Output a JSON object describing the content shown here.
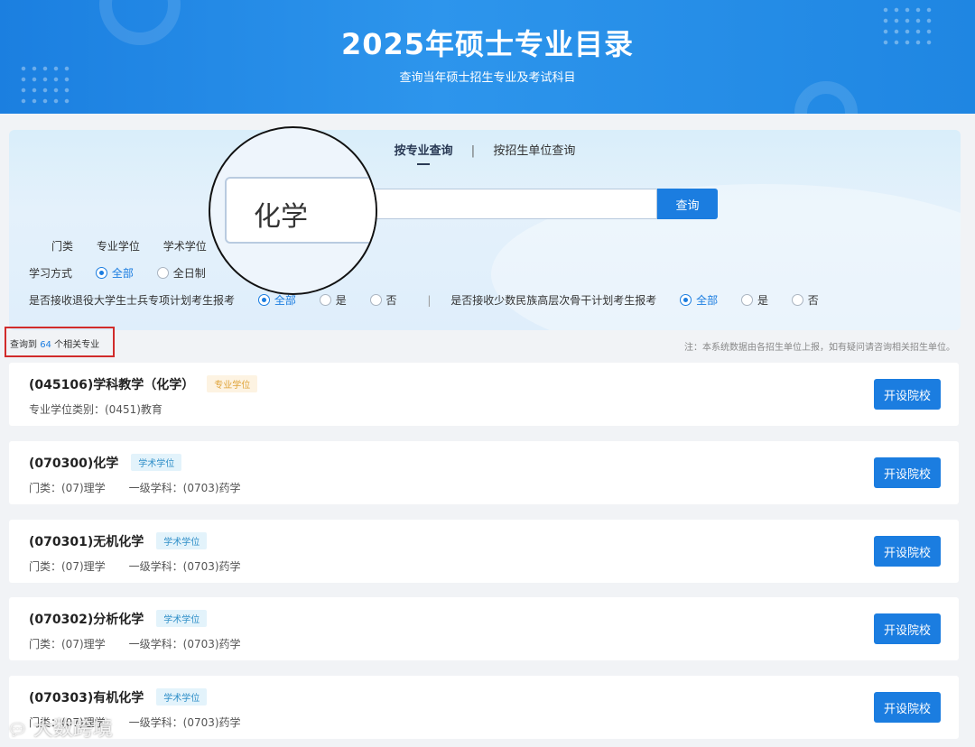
{
  "banner": {
    "title": "2025年硕士专业目录",
    "subtitle": "查询当年硕士招生专业及考试科目"
  },
  "tabs": [
    {
      "label": "按专业查询",
      "active": true
    },
    {
      "label": "按招生单位查询",
      "active": false
    }
  ],
  "tab_separator": "|",
  "search": {
    "value": "化学",
    "placeholder": "",
    "button_label": "查询"
  },
  "filters": {
    "category": {
      "label": "门类",
      "options": [
        "专业学位",
        "学术学位"
      ]
    },
    "study_mode": {
      "label": "学习方式",
      "options": [
        {
          "label": "全部",
          "selected": true
        },
        {
          "label": "全日制",
          "selected": false
        }
      ]
    },
    "veteran_plan": {
      "label": "是否接收退役大学生士兵专项计划考生报考",
      "options": [
        {
          "label": "全部",
          "selected": true
        },
        {
          "label": "是",
          "selected": false
        },
        {
          "label": "否",
          "selected": false
        }
      ]
    },
    "minority_plan": {
      "label": "是否接收少数民族高层次骨干计划考生报考",
      "options": [
        {
          "label": "全部",
          "selected": true
        },
        {
          "label": "是",
          "selected": false
        },
        {
          "label": "否",
          "selected": false
        }
      ]
    },
    "separator": "|"
  },
  "results": {
    "prefix": "查询到",
    "count": "64",
    "suffix": "个相关专业",
    "note": "注：本系统数据由各招生单位上报，如有疑问请咨询相关招生单位。"
  },
  "majors": [
    {
      "title": "(045106)学科教学（化学）",
      "tag": "专业学位",
      "tag_type": "pro",
      "meta": [
        "专业学位类别：(0451)教育"
      ],
      "button": "开设院校"
    },
    {
      "title": "(070300)化学",
      "tag": "学术学位",
      "tag_type": "aca",
      "meta": [
        "门类：(07)理学",
        "一级学科：(0703)药学"
      ],
      "button": "开设院校"
    },
    {
      "title": "(070301)无机化学",
      "tag": "学术学位",
      "tag_type": "aca",
      "meta": [
        "门类：(07)理学",
        "一级学科：(0703)药学"
      ],
      "button": "开设院校"
    },
    {
      "title": "(070302)分析化学",
      "tag": "学术学位",
      "tag_type": "aca",
      "meta": [
        "门类：(07)理学",
        "一级学科：(0703)药学"
      ],
      "button": "开设院校"
    },
    {
      "title": "(070303)有机化学",
      "tag": "学术学位",
      "tag_type": "aca",
      "meta": [
        "门类：(07)理学",
        "一级学科：(0703)药学"
      ],
      "button": "开设院校"
    }
  ],
  "watermark": {
    "text": "大数跨境",
    "icon": "chat-bubble-icon"
  },
  "colors": {
    "primary": "#1b7de0",
    "highlight_border": "#d12b2b",
    "tag_pro": "#e0a43a",
    "tag_aca": "#2f8fc8"
  }
}
